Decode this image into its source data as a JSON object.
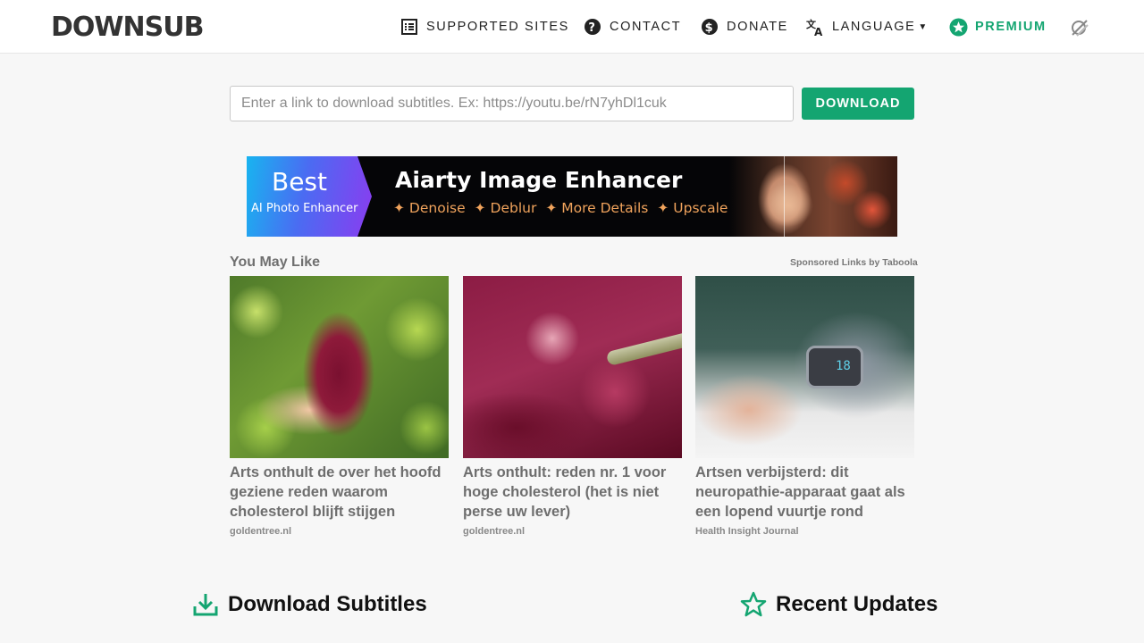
{
  "header": {
    "logo": "DOWNSUB",
    "nav": {
      "supported_sites": "SUPPORTED SITES",
      "contact": "CONTACT",
      "donate": "DONATE",
      "language": "LANGUAGE",
      "premium": "PREMIUM"
    },
    "icons": [
      "list-icon",
      "help-circle-icon",
      "dollar-circle-icon",
      "translate-icon",
      "star-badge-icon",
      "theme-toggle-icon"
    ]
  },
  "search": {
    "placeholder": "Enter a link to download subtitles. Ex: https://youtu.be/rN7yhDl1cuk",
    "value": "",
    "button_label": "DOWNLOAD"
  },
  "ad": {
    "best": "Best",
    "subtitle": "AI Photo Enhancer",
    "title": "Aiarty Image Enhancer",
    "features": [
      "✦ Denoise",
      "✦ Deblur",
      "✦ More Details",
      "✦ Upscale"
    ]
  },
  "recommendations": {
    "heading": "You May Like",
    "sponsored": "Sponsored Links by Taboola",
    "cards": [
      {
        "title": "Arts onthult de over het hoofd geziene reden waarom cholesterol blijft stijgen",
        "source": "goldentree.nl"
      },
      {
        "title": "Arts onthult: reden nr. 1 voor hoge cholesterol (het is niet perse uw lever)",
        "source": "goldentree.nl"
      },
      {
        "title": "Artsen verbijsterd: dit neuropathie-apparaat gaat als een lopend vuurtje rond",
        "source": "Health Insight Journal",
        "device_display": "18"
      }
    ]
  },
  "sections": {
    "download_subtitles": "Download Subtitles",
    "recent_updates": "Recent Updates"
  },
  "colors": {
    "accent": "#14a571",
    "background": "#f7f7f7",
    "header_bg": "#ffffff"
  }
}
